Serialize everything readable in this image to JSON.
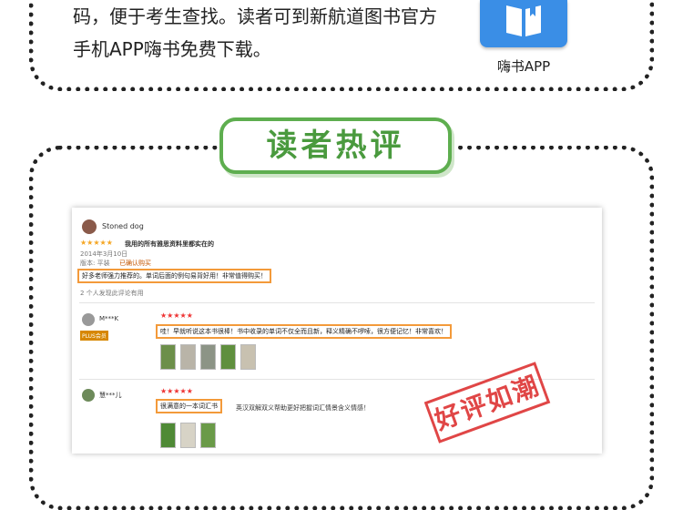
{
  "intro": {
    "lines": [
      "码，便于考生查找。读者可到新航道图书官方",
      "手机APP嗨书免费下载。"
    ]
  },
  "app": {
    "label": "嗨书APP",
    "icon": "book-icon",
    "color": "#3a8ee6"
  },
  "section": {
    "title": "读者热评",
    "accent": "#5eae4f"
  },
  "review1": {
    "user": "Stoned dog",
    "stars": "★★★★★",
    "headline": "我用的所有雅思资料里都实在的",
    "date": "2014年3月10日",
    "format": "版本: 平装",
    "verified": "已确认购买",
    "body": "好多老师强力推荐的。单词后面的例句易背好用！非常值得购买！",
    "helpful": "2 个人发现此评论有用"
  },
  "review2": {
    "user": "M***K",
    "badge": "PLUS会员",
    "stars": "★★★★★",
    "body": "哇！早就听说这本书很棒！书中收录的单词不仅全而且新，释义精确不啰嗦，很方便记忆！非常喜欢！"
  },
  "review3": {
    "user": "慧***儿",
    "stars": "★★★★★",
    "body_highlight": "很满意的一本词汇书",
    "body_rest": "英汉双解双义帮助更好把握词汇情景含义情感！"
  },
  "stamp": {
    "text": "好评如潮",
    "color": "#d33"
  }
}
